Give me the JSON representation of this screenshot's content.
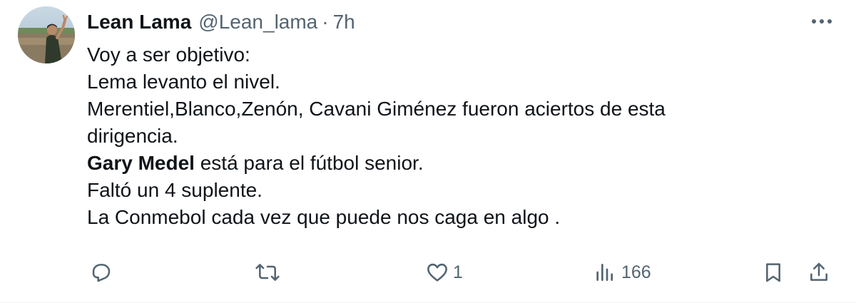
{
  "tweet": {
    "author": {
      "name": "Lean Lama",
      "handle": "@Lean_lama",
      "separator": "·",
      "time": "7h"
    },
    "body_lines": [
      "Voy a ser objetivo:",
      "Lema levanto el nivel.",
      "Merentiel,Blanco,Zenón, Cavani Giménez fueron aciertos de esta",
      "dirigencia."
    ],
    "bold_line": {
      "bold": "Gary Medel",
      "rest": " está para el fútbol senior."
    },
    "body_lines_after": [
      "Faltó un 4 suplente.",
      "La Conmebol cada vez que puede nos caga en algo ."
    ],
    "actions": {
      "reply_icon": "reply-icon",
      "retweet_icon": "retweet-icon",
      "like_icon": "heart-icon",
      "like_count": "1",
      "views_icon": "views-icon",
      "views_count": "166",
      "bookmark_icon": "bookmark-icon",
      "share_icon": "share-icon"
    },
    "more_icon": "more-icon"
  },
  "colors": {
    "text": "#0f1419",
    "secondary": "#536471",
    "border": "#eff3f4"
  }
}
